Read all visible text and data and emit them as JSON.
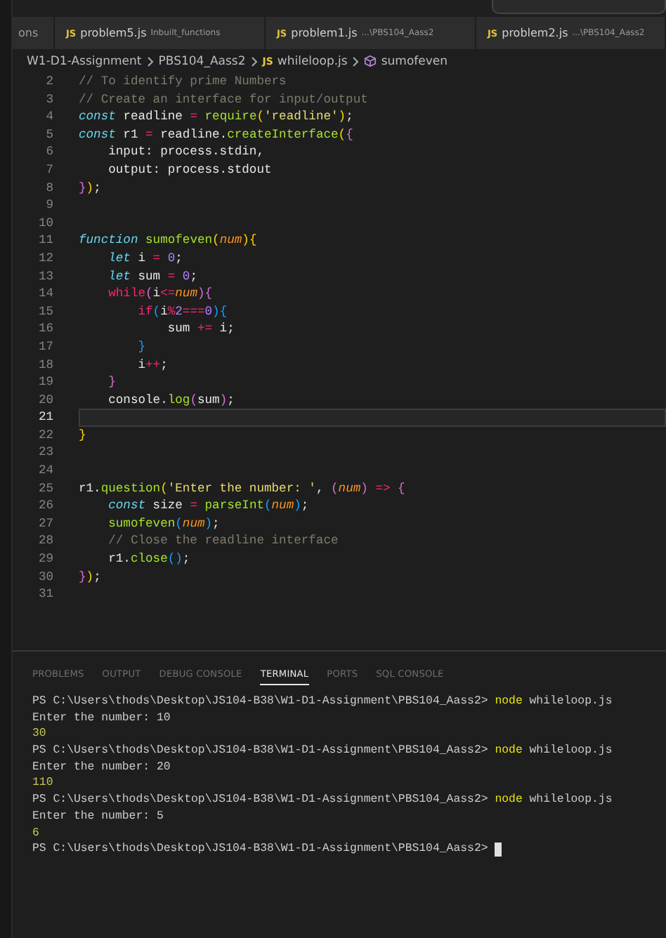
{
  "tabs": [
    {
      "label": "ons"
    },
    {
      "icon_text": "JS",
      "label": "problem5.js",
      "description": "Inbuilt_functions"
    },
    {
      "icon_text": "JS",
      "label": "problem1.js",
      "description": "...\\PBS104_Aass2"
    },
    {
      "icon_text": "JS",
      "label": "problem2.js",
      "description": "...\\PBS104_Aass2"
    }
  ],
  "breadcrumb": [
    {
      "label": "W1-D1-Assignment",
      "kind": "folder"
    },
    {
      "label": "PBS104_Aass2",
      "kind": "folder"
    },
    {
      "label": "whileloop.js",
      "kind": "file",
      "icon_text": "JS"
    },
    {
      "label": "sumofeven",
      "kind": "symbol"
    }
  ],
  "editor": {
    "lines": [
      {
        "number": "2",
        "current": false,
        "tokens": [
          {
            "text": "// To identify prime Numbers",
            "kind": "comment"
          }
        ]
      },
      {
        "number": "3",
        "current": false,
        "tokens": [
          {
            "text": "// Create an interface for input/output",
            "kind": "comment"
          }
        ]
      },
      {
        "number": "4",
        "current": false,
        "tokens": [
          {
            "text": "const ",
            "kind": "keyword"
          },
          {
            "text": "readline ",
            "kind": "variable"
          },
          {
            "text": "= ",
            "kind": "operator"
          },
          {
            "text": "require",
            "kind": "function"
          },
          {
            "text": "(",
            "kind": "bracket1"
          },
          {
            "text": "'readline'",
            "kind": "string"
          },
          {
            "text": ")",
            "kind": "bracket1"
          },
          {
            "text": ";",
            "kind": "plain"
          }
        ]
      },
      {
        "number": "5",
        "current": false,
        "tokens": [
          {
            "text": "const",
            "kind": "keyword"
          },
          {
            "text": " r1 ",
            "kind": "plain"
          },
          {
            "text": "= ",
            "kind": "operator"
          },
          {
            "text": "readline",
            "kind": "variable"
          },
          {
            "text": ".",
            "kind": "plain"
          },
          {
            "text": "createInterface",
            "kind": "function"
          },
          {
            "text": "(",
            "kind": "bracket1"
          },
          {
            "text": "{",
            "kind": "bracket2"
          }
        ]
      },
      {
        "number": "6",
        "current": false,
        "tokens": [
          {
            "text": "    input: process.stdin,",
            "kind": "plain"
          }
        ]
      },
      {
        "number": "7",
        "current": false,
        "tokens": [
          {
            "text": "    output: process.stdout",
            "kind": "plain"
          }
        ]
      },
      {
        "number": "8",
        "current": false,
        "tokens": [
          {
            "text": "}",
            "kind": "bracket2"
          },
          {
            "text": ")",
            "kind": "bracket1"
          },
          {
            "text": ";",
            "kind": "plain"
          }
        ]
      },
      {
        "number": "9",
        "current": false
      },
      {
        "number": "10",
        "current": false
      },
      {
        "number": "11",
        "current": false,
        "tokens": [
          {
            "text": "function ",
            "kind": "keyword"
          },
          {
            "text": "sumofeven",
            "kind": "function"
          },
          {
            "text": "(",
            "kind": "bracket1"
          },
          {
            "text": "num",
            "kind": "param"
          },
          {
            "text": ")",
            "kind": "bracket1"
          },
          {
            "text": "{",
            "kind": "bracket1"
          }
        ]
      },
      {
        "number": "12",
        "current": false,
        "tokens": [
          {
            "text": "    let",
            "kind": "keyword"
          },
          {
            "text": " i ",
            "kind": "plain"
          },
          {
            "text": "= ",
            "kind": "operator"
          },
          {
            "text": "0",
            "kind": "number"
          },
          {
            "text": ";",
            "kind": "plain"
          }
        ]
      },
      {
        "number": "13",
        "current": false,
        "tokens": [
          {
            "text": "    let",
            "kind": "keyword"
          },
          {
            "text": " sum ",
            "kind": "plain"
          },
          {
            "text": "= ",
            "kind": "operator"
          },
          {
            "text": "0",
            "kind": "number"
          },
          {
            "text": ";",
            "kind": "plain"
          }
        ]
      },
      {
        "number": "14",
        "current": false,
        "tokens": [
          {
            "text": "    while",
            "kind": "control"
          },
          {
            "text": "(",
            "kind": "bracket2"
          },
          {
            "text": "i",
            "kind": "plain"
          },
          {
            "text": "<=",
            "kind": "operator"
          },
          {
            "text": "num",
            "kind": "param"
          },
          {
            "text": ")",
            "kind": "bracket2"
          },
          {
            "text": "{",
            "kind": "bracket2"
          }
        ]
      },
      {
        "number": "15",
        "current": false,
        "tokens": [
          {
            "text": "        if",
            "kind": "control"
          },
          {
            "text": "(",
            "kind": "bracket3"
          },
          {
            "text": "i",
            "kind": "plain"
          },
          {
            "text": "%",
            "kind": "operator"
          },
          {
            "text": "2",
            "kind": "number"
          },
          {
            "text": "===",
            "kind": "operator"
          },
          {
            "text": "0",
            "kind": "number"
          },
          {
            "text": ")",
            "kind": "bracket3"
          },
          {
            "text": "{",
            "kind": "bracket3"
          }
        ]
      },
      {
        "number": "16",
        "current": false,
        "tokens": [
          {
            "text": "            sum ",
            "kind": "plain"
          },
          {
            "text": "+=",
            "kind": "operator"
          },
          {
            "text": " i;",
            "kind": "plain"
          }
        ]
      },
      {
        "number": "17",
        "current": false,
        "tokens": [
          {
            "text": "        }",
            "kind": "bracket3"
          }
        ]
      },
      {
        "number": "18",
        "current": false,
        "tokens": [
          {
            "text": "        i",
            "kind": "plain"
          },
          {
            "text": "++",
            "kind": "operator"
          },
          {
            "text": ";",
            "kind": "plain"
          }
        ]
      },
      {
        "number": "19",
        "current": false,
        "tokens": [
          {
            "text": "    }",
            "kind": "bracket2"
          }
        ]
      },
      {
        "number": "20",
        "current": false,
        "tokens": [
          {
            "text": "    console.",
            "kind": "plain"
          },
          {
            "text": "log",
            "kind": "function"
          },
          {
            "text": "(",
            "kind": "bracket2"
          },
          {
            "text": "sum",
            "kind": "plain"
          },
          {
            "text": ")",
            "kind": "bracket2"
          },
          {
            "text": ";",
            "kind": "plain"
          }
        ]
      },
      {
        "number": "21",
        "current": true
      },
      {
        "number": "22",
        "current": false,
        "tokens": [
          {
            "text": "}",
            "kind": "bracket1"
          }
        ]
      },
      {
        "number": "23",
        "current": false
      },
      {
        "number": "24",
        "current": false
      },
      {
        "number": "25",
        "current": false,
        "tokens": [
          {
            "text": "r1.",
            "kind": "plain"
          },
          {
            "text": "question",
            "kind": "function"
          },
          {
            "text": "(",
            "kind": "bracket1"
          },
          {
            "text": "'Enter the number: '",
            "kind": "string"
          },
          {
            "text": ", ",
            "kind": "plain"
          },
          {
            "text": "(",
            "kind": "bracket2"
          },
          {
            "text": "num",
            "kind": "param"
          },
          {
            "text": ") ",
            "kind": "bracket2"
          },
          {
            "text": "=> ",
            "kind": "operator"
          },
          {
            "text": "{",
            "kind": "bracket2"
          }
        ]
      },
      {
        "number": "26",
        "current": false,
        "tokens": [
          {
            "text": "    const",
            "kind": "keyword"
          },
          {
            "text": " size ",
            "kind": "plain"
          },
          {
            "text": "= ",
            "kind": "operator"
          },
          {
            "text": "parseInt",
            "kind": "function"
          },
          {
            "text": "(",
            "kind": "bracket3"
          },
          {
            "text": "num",
            "kind": "param"
          },
          {
            "text": ")",
            "kind": "bracket3"
          },
          {
            "text": ";",
            "kind": "plain"
          }
        ]
      },
      {
        "number": "27",
        "current": false,
        "tokens": [
          {
            "text": "    sumofeven",
            "kind": "function"
          },
          {
            "text": "(",
            "kind": "bracket3"
          },
          {
            "text": "num",
            "kind": "param"
          },
          {
            "text": ")",
            "kind": "bracket3"
          },
          {
            "text": ";",
            "kind": "plain"
          }
        ]
      },
      {
        "number": "28",
        "current": false,
        "tokens": [
          {
            "text": "    // Close the readline interface",
            "kind": "comment"
          }
        ]
      },
      {
        "number": "29",
        "current": false,
        "tokens": [
          {
            "text": "    r1.",
            "kind": "plain"
          },
          {
            "text": "close",
            "kind": "function"
          },
          {
            "text": "(",
            "kind": "bracket3"
          },
          {
            "text": ")",
            "kind": "bracket3"
          },
          {
            "text": ";",
            "kind": "plain"
          }
        ]
      },
      {
        "number": "30",
        "current": false,
        "tokens": [
          {
            "text": "}",
            "kind": "bracket2"
          },
          {
            "text": ")",
            "kind": "bracket1"
          },
          {
            "text": ";",
            "kind": "plain"
          }
        ]
      },
      {
        "number": "31",
        "current": false
      }
    ]
  },
  "panel": {
    "tabs": [
      {
        "label": "PROBLEMS",
        "selected": false
      },
      {
        "label": "OUTPUT",
        "selected": false
      },
      {
        "label": "DEBUG CONSOLE",
        "selected": false
      },
      {
        "label": "TERMINAL",
        "selected": true
      },
      {
        "label": "PORTS",
        "selected": false
      },
      {
        "label": "SQL CONSOLE",
        "selected": false
      }
    ],
    "terminal": [
      {
        "cursor": false,
        "tokens": [
          {
            "text": "PS C:\\Users\\thods\\Desktop\\JS104-B38\\W1-D1-Assignment\\PBS104_Aass2> ",
            "kind": "plain"
          },
          {
            "text": "node",
            "kind": "command"
          },
          {
            "text": " whileloop.js",
            "kind": "plain"
          }
        ]
      },
      {
        "cursor": false,
        "tokens": [
          {
            "text": "Enter the number: 10",
            "kind": "plain"
          }
        ]
      },
      {
        "cursor": false,
        "tokens": [
          {
            "text": "30",
            "kind": "output"
          }
        ]
      },
      {
        "cursor": false,
        "tokens": [
          {
            "text": "PS C:\\Users\\thods\\Desktop\\JS104-B38\\W1-D1-Assignment\\PBS104_Aass2> ",
            "kind": "plain"
          },
          {
            "text": "node",
            "kind": "command"
          },
          {
            "text": " whileloop.js",
            "kind": "plain"
          }
        ]
      },
      {
        "cursor": false,
        "tokens": [
          {
            "text": "Enter the number: 20",
            "kind": "plain"
          }
        ]
      },
      {
        "cursor": false,
        "tokens": [
          {
            "text": "110",
            "kind": "output"
          }
        ]
      },
      {
        "cursor": false,
        "tokens": [
          {
            "text": "PS C:\\Users\\thods\\Desktop\\JS104-B38\\W1-D1-Assignment\\PBS104_Aass2> ",
            "kind": "plain"
          },
          {
            "text": "node",
            "kind": "command"
          },
          {
            "text": " whileloop.js",
            "kind": "plain"
          }
        ]
      },
      {
        "cursor": false,
        "tokens": [
          {
            "text": "Enter the number: 5",
            "kind": "plain"
          }
        ]
      },
      {
        "cursor": false,
        "tokens": [
          {
            "text": "6",
            "kind": "output"
          }
        ]
      },
      {
        "cursor": true,
        "tokens": [
          {
            "text": "PS C:\\Users\\thods\\Desktop\\JS104-B38\\W1-D1-Assignment\\PBS104_Aass2> ",
            "kind": "plain"
          }
        ]
      }
    ]
  }
}
